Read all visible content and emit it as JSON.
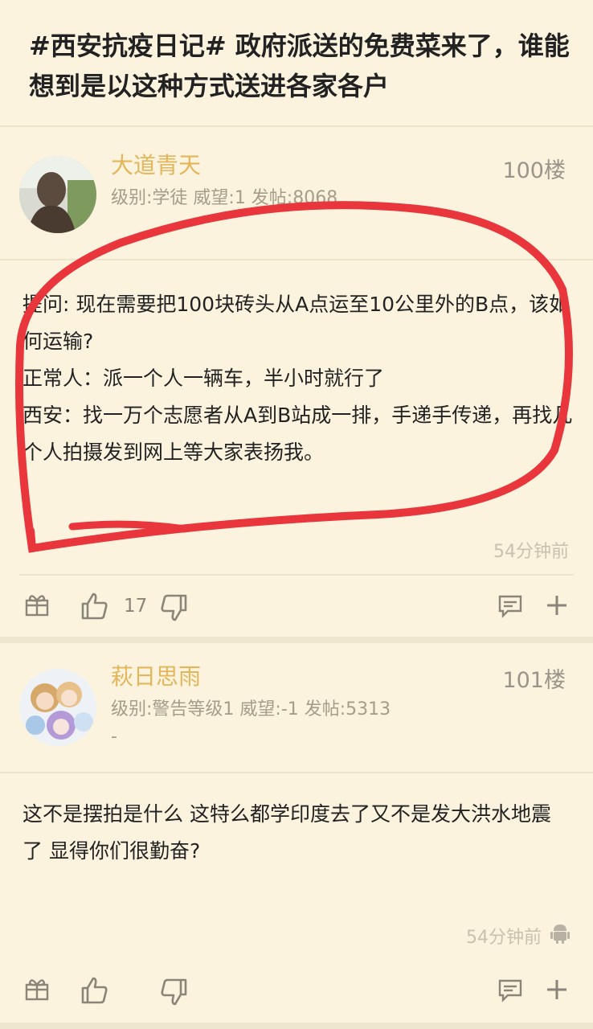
{
  "thread": {
    "title": "#西安抗疫日记# 政府派送的免费菜来了，谁能想到是以这种方式送进各家各户"
  },
  "posts": [
    {
      "username": "大道青天",
      "meta": "级别:学徒 威望:1 发帖:8068",
      "floor": "100楼",
      "content": [
        "提问: 现在需要把100块砖头从A点运至10公里外的B点，该如何运输?",
        "正常人：派一个人一辆车，半小时就行了",
        "西安：找一万个志愿者从A到B站成一排，手递手传递，再找几个人拍摄发到网上等大家表扬我。"
      ],
      "time": "54分钟前",
      "likes": "17",
      "annotation_color": "#e8363c"
    },
    {
      "username": "萩日思雨",
      "meta": "级别:警告等级1 威望:-1 发帖:5313",
      "meta_extra": "-",
      "floor": "101楼",
      "content": [
        "这不是摆拍是什么 这特么都学印度去了又不是发大洪水地震了 显得你们很勤奋?"
      ],
      "time": "54分钟前",
      "likes": ""
    }
  ],
  "icons": [
    "gift-icon",
    "thumb-up-icon",
    "thumb-down-icon",
    "comment-icon",
    "plus-icon",
    "android-icon"
  ],
  "colors": {
    "background": "#fbf3de",
    "username": "#e3b65c",
    "annotation": "#e8363c"
  }
}
